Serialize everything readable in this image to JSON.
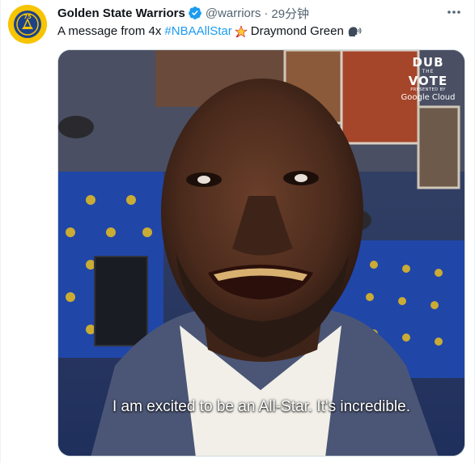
{
  "tweet": {
    "display_name": "Golden State Warriors",
    "handle": "@warriors",
    "separator": "·",
    "time": "29分钟",
    "text_prefix": "A message from 4x",
    "hashtag": "#NBAAllStar",
    "text_suffix": "Draymond Green",
    "verified_color": "#1d9bf0",
    "avatar_bg": "#f7c400",
    "avatar_logo_text": "75"
  },
  "media": {
    "caption": "I am excited to be an All-Star. It's incredible.",
    "logo": {
      "line1": "DUB",
      "line2": "THE",
      "line3": "VOTE",
      "presented": "PRESENTED BY",
      "sponsor": "Google Cloud"
    }
  },
  "icons": {
    "avatar": "warriors-75-logo-icon",
    "verified": "verified-badge-icon",
    "more": "more-icon",
    "star": "star-emoji-icon",
    "speaking": "speaking-head-emoji-icon"
  }
}
